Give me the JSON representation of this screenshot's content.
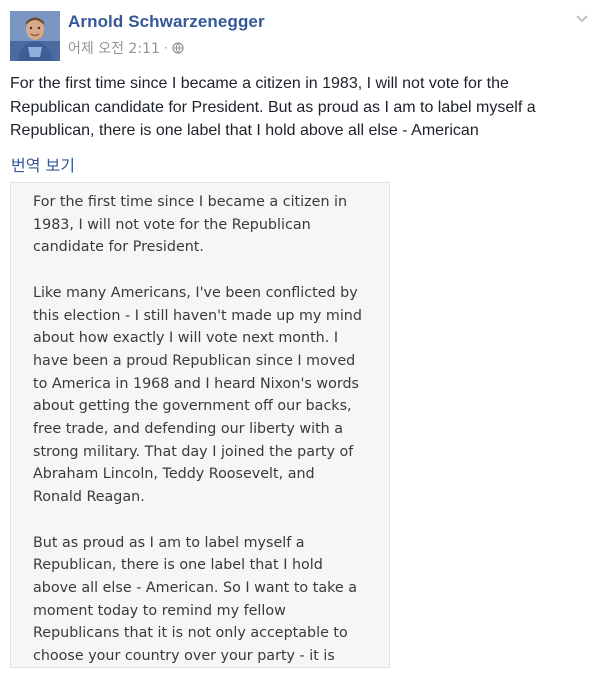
{
  "post": {
    "author": "Arnold Schwarzenegger",
    "timestamp": "어제 오전 2:11",
    "separator": "·",
    "privacy_icon": "globe-icon",
    "menu_icon": "chevron-down-icon",
    "text_lines": [
      "For the first time since I became a citizen in 1983, I will not vote for the",
      "Republican candidate for President. But as proud as I am to label myself a",
      "Republican, there is one label that I hold above all else - American"
    ],
    "translate_link": "번역 보기"
  },
  "image": {
    "paragraphs": [
      "For the first time since I became a citizen in 1983, I will not vote for the Republican candidate for President.",
      "Like many Americans, I've been conflicted by this election - I still haven't made up my mind about how exactly I will vote next month. I have been a proud Republican since I moved to America in 1968 and I heard Nixon's words about getting the government off our backs, free trade, and defending our liberty with a strong military. That day I joined the party of Abraham Lincoln, Teddy Roosevelt, and Ronald Reagan.",
      "But as proud as I am to label myself a Republican, there is one label that I hold above all else - American. So I want to take a moment today to remind my fellow Republicans that it is not only acceptable to choose your country over your party - it is your duty."
    ]
  },
  "colors": {
    "author": "#365899",
    "meta": "#90949c",
    "text": "#1d2129",
    "image_bg": "#f6f6f6"
  }
}
